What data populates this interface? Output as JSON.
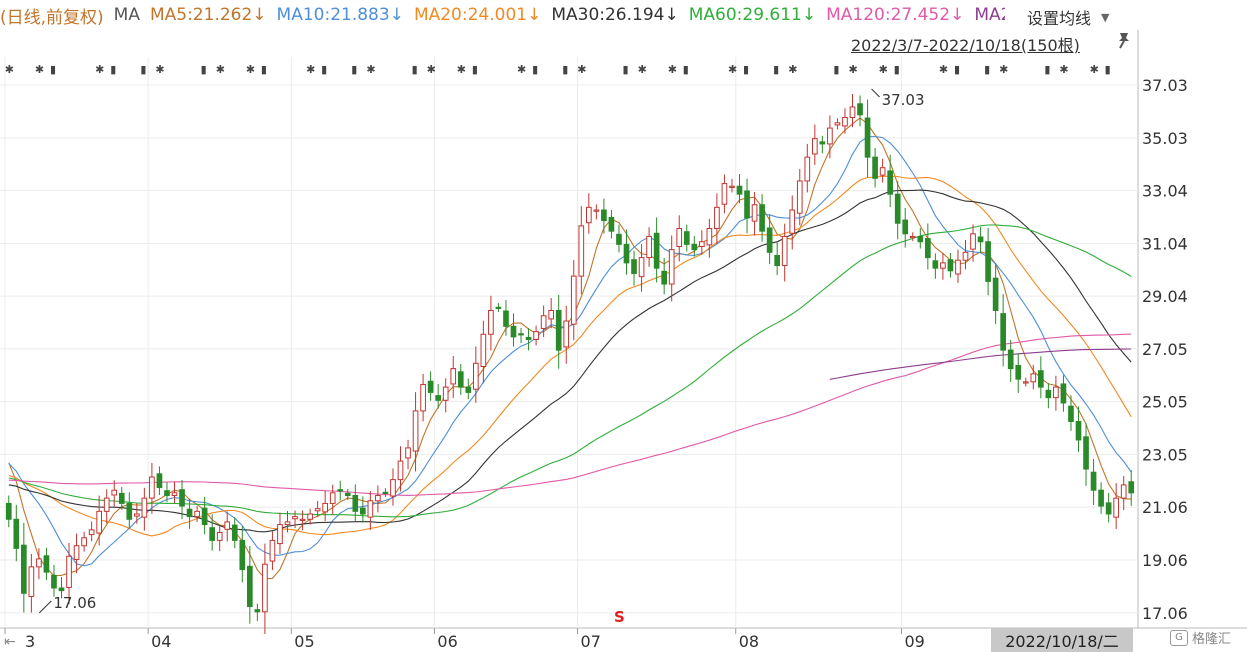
{
  "legend": {
    "period": "(日线,前复权)",
    "ma_label": "MA",
    "items": [
      {
        "text": "MA5:21.262↓",
        "color": "#c0752b"
      },
      {
        "text": "MA10:21.883↓",
        "color": "#4f8fd6"
      },
      {
        "text": "MA20:24.001↓",
        "color": "#f08a23"
      },
      {
        "text": "MA30:26.194↓",
        "color": "#333333"
      },
      {
        "text": "MA60:29.611↓",
        "color": "#2fae3a"
      },
      {
        "text": "MA120:27.452↓",
        "color": "#e05aa8"
      },
      {
        "text": "MA2",
        "color": "#8e3d8e"
      }
    ]
  },
  "settings_label": "设置均线",
  "date_range": "2022/3/7-2022/10/18(150根)",
  "crosshair_date": "2022/10/18/二",
  "watermark": "格隆汇",
  "chart_data": {
    "type": "candlestick",
    "y_ticks": [
      "37.03",
      "35.03",
      "33.04",
      "31.04",
      "29.04",
      "27.05",
      "25.05",
      "23.05",
      "21.06",
      "19.06",
      "17.06"
    ],
    "ylim": [
      16.6,
      37.9
    ],
    "x_labels": [
      "3",
      "04",
      "05",
      "06",
      "07",
      "08",
      "09"
    ],
    "month_start_index": [
      0,
      19,
      38,
      57,
      76,
      97,
      119
    ],
    "annotations": [
      {
        "text": "37.03",
        "kind": "high",
        "index": 114,
        "value": 37.03
      },
      {
        "text": "17.06",
        "kind": "low",
        "index": 3,
        "value": 17.06
      }
    ],
    "special_marker": {
      "text": "S",
      "index": 81,
      "color": "#e02020"
    },
    "ma_last": {
      "MA5": 21.262,
      "MA10": 21.883,
      "MA20": 24.001,
      "MA30": 26.194,
      "MA60": 29.611,
      "MA120": 27.452
    },
    "colors": {
      "up": "#c23531",
      "down": "#2a8a2a",
      "ma5": "#c0752b",
      "ma10": "#4f8fd6",
      "ma20": "#f08a23",
      "ma30": "#333333",
      "ma60": "#2fae3a",
      "ma120": "#e05aa8",
      "ma250": "#8e3d8e"
    },
    "closes": [
      20.6,
      19.5,
      17.8,
      18.8,
      19.1,
      18.6,
      18.0,
      17.9,
      19.2,
      19.6,
      19.9,
      20.2,
      20.9,
      21.4,
      21.7,
      21.2,
      20.6,
      20.8,
      21.4,
      22.2,
      21.8,
      21.5,
      21.6,
      21.1,
      20.7,
      20.9,
      20.4,
      19.8,
      20.1,
      20.5,
      19.8,
      18.7,
      17.3,
      17.1,
      18.9,
      19.8,
      20.4,
      20.5,
      20.7,
      20.6,
      20.8,
      21.0,
      21.2,
      21.6,
      21.7,
      21.5,
      20.9,
      20.8,
      21.3,
      21.5,
      21.6,
      22.1,
      22.8,
      23.3,
      24.7,
      25.7,
      25.4,
      25.1,
      25.6,
      26.3,
      25.6,
      25.4,
      26.5,
      27.6,
      28.5,
      28.6,
      27.9,
      27.5,
      27.6,
      27.4,
      27.7,
      28.3,
      28.5,
      27.0,
      28.1,
      29.8,
      31.7,
      32.4,
      32.3,
      31.9,
      31.5,
      31.0,
      30.3,
      29.9,
      30.5,
      31.3,
      30.1,
      29.5,
      30.8,
      31.6,
      31.0,
      30.8,
      31.1,
      31.6,
      32.4,
      33.3,
      33.2,
      32.9,
      32.0,
      32.5,
      31.5,
      30.7,
      30.2,
      31.3,
      32.3,
      33.4,
      34.3,
      35.0,
      34.8,
      35.4,
      35.6,
      35.8,
      36.2,
      35.9,
      34.3,
      33.5,
      33.9,
      32.9,
      31.8,
      31.4,
      31.3,
      31.1,
      30.5,
      30.1,
      30.3,
      30.0,
      30.4,
      30.7,
      31.4,
      31.1,
      29.6,
      28.5,
      27.0,
      26.3,
      25.9,
      25.8,
      26.1,
      25.6,
      25.2,
      25.6,
      25.0,
      24.3,
      23.6,
      22.5,
      21.7,
      21.1,
      20.8,
      21.4,
      21.9,
      21.6
    ]
  }
}
